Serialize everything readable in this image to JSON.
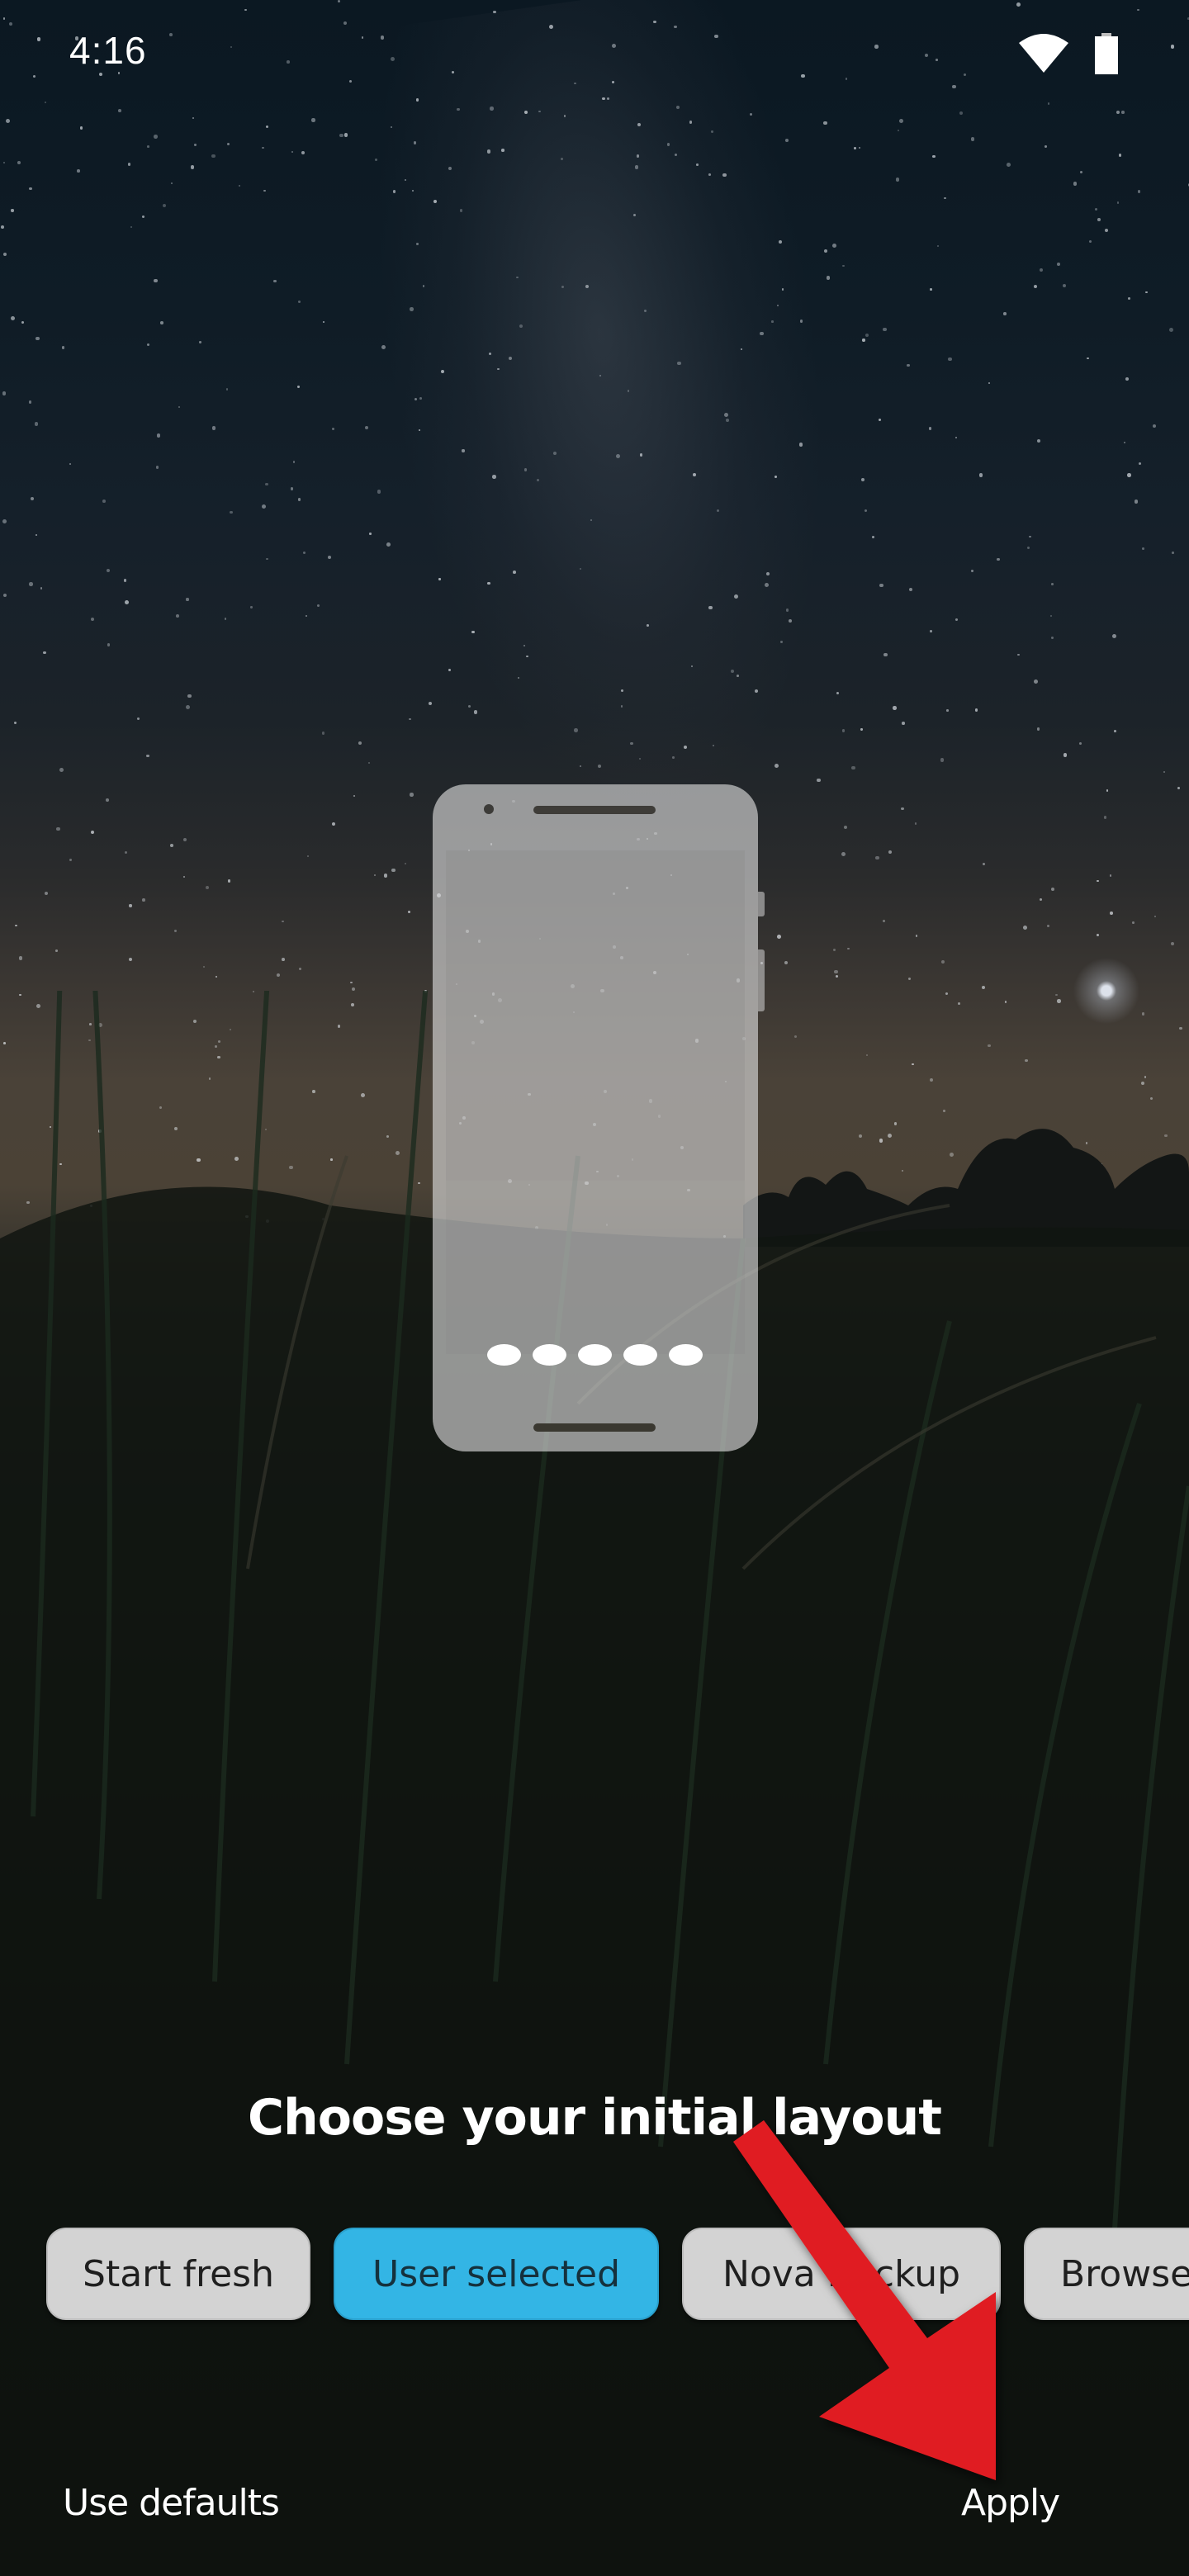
{
  "status_bar": {
    "time": "4:16",
    "icons": [
      "wifi-icon",
      "battery-icon"
    ]
  },
  "wallpaper": {
    "description": "night sky with milky way over tall grass field"
  },
  "preview": {
    "dock_icon_count": 5
  },
  "layout_chooser": {
    "title": "Choose your initial layout",
    "options": [
      {
        "label": "Start fresh",
        "selected": false
      },
      {
        "label": "User selected",
        "selected": true
      },
      {
        "label": "Nova Backup",
        "selected": false
      },
      {
        "label": "Browse",
        "selected": false
      }
    ]
  },
  "footer": {
    "use_defaults_label": "Use defaults",
    "apply_label": "Apply"
  },
  "annotation": {
    "type": "arrow",
    "color": "#e01e24",
    "points_to": "apply-button"
  },
  "colors": {
    "accent": "#33b5e5",
    "chip_background": "#d3d3d3",
    "text_light": "#ffffff"
  }
}
